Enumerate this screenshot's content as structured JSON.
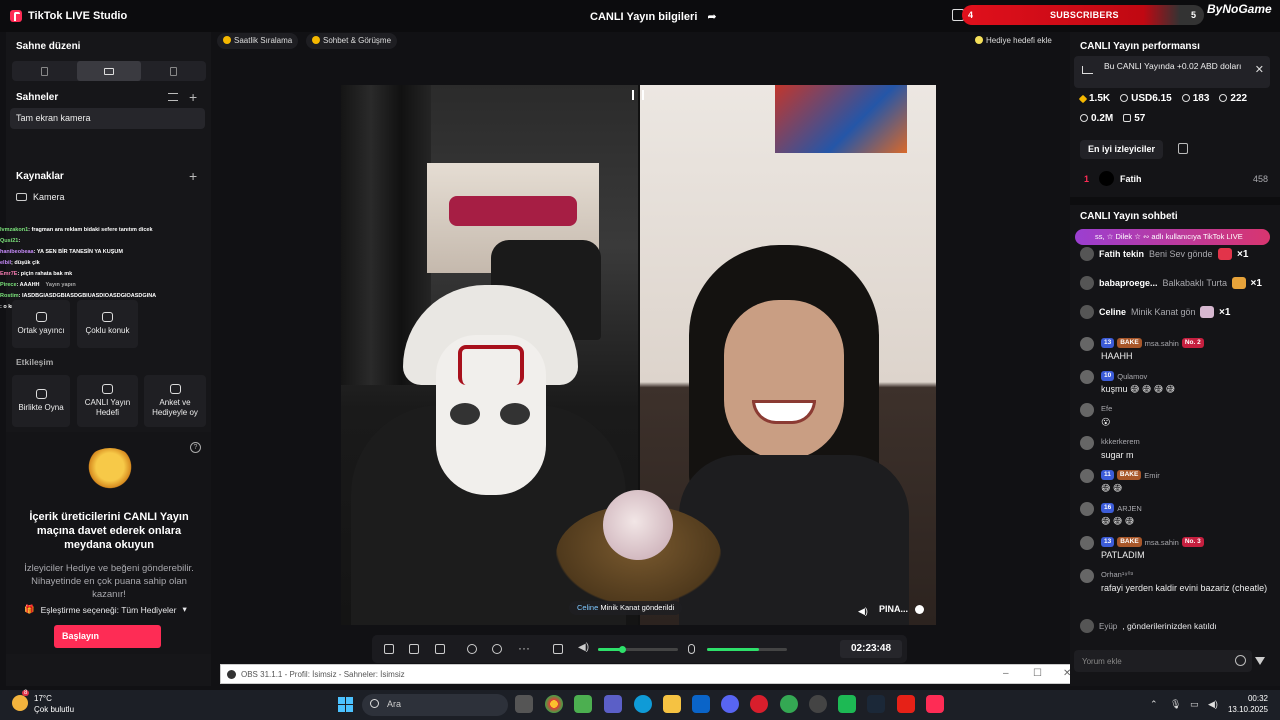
{
  "app": {
    "title": "TikTok LIVE Studio",
    "live_info_title": "CANLI Yayın bilgileri",
    "subscribers": {
      "left": "4",
      "label": "SUBSCRIBERS",
      "right": "5"
    },
    "brand": "ByNoGame"
  },
  "left": {
    "scene_layout_title": "Sahne düzeni",
    "scenes_title": "Sahneler",
    "scene_item": "Tam ekran kamera",
    "sources_title": "Kaynaklar",
    "source_item": "Kamera",
    "overlay_chat": [
      {
        "name": "lvmzakon1",
        "text": ": fragman ara reklam bidaki sefere tanıtım dicek"
      },
      {
        "name": "Qusi21",
        "text": ":"
      },
      {
        "name": "hanibeobeaa",
        "text": ": YA SEN BİR TANESİN YA KUŞUM"
      },
      {
        "name": "elbil",
        "text": "; düşük çik"
      },
      {
        "name": "Emr7E",
        "text": ": piçin rahata bak mk"
      },
      {
        "name": "Pirece",
        "text": ": AAAHH"
      },
      {
        "name": "Rostim",
        "text": ": IASDBGIASDGBIASDGBIUASDIOASDGIOASDGINA"
      },
      {
        "name": "",
        "text": ": o kızan fosil geç"
      }
    ],
    "invite_label": "Yayın yapın",
    "tiles": [
      {
        "label": "Ortak yayıncı"
      },
      {
        "label": "Çoklu konuk"
      },
      {
        "label": "Birlikte Oyna"
      },
      {
        "label": "CANLI Yayın Hedefi"
      },
      {
        "label": "Anket ve Hediyeyle oy"
      }
    ],
    "interaction_title": "Etkileşim",
    "promo": {
      "title": "İçerik üreticilerini CANLI Yayın maçına davet ederek onlara meydana okuyun",
      "body": "İzleyiciler Hediye ve beğeni gönderebilir. Nihayetinde en çok puana sahip olan kazanır!",
      "match_label": "Eşleştirme seçeneği: Tüm Hediyeler",
      "start_button": "Başlayın"
    }
  },
  "center": {
    "pills": [
      "Saatlik Sıralama",
      "Sohbet & Görüşme"
    ],
    "gift_goal": "Hediye hedefi ekle",
    "gift_toast": {
      "name": "Celine",
      "text": "Minik Kanat gönderildi"
    },
    "guest_name": "PINA...",
    "timer": "02:23:48",
    "mic_level": 0.3,
    "speaker_level": 0.65
  },
  "obs": {
    "title": "OBS 31.1.1 - Profil: İsimsiz - Sahneler: İsimsiz"
  },
  "right": {
    "performance_title": "CANLI Yayın performansı",
    "earn_text": "Bu CANLI Yayında +0.02 ABD doları",
    "stats": {
      "diamonds": "1.5K",
      "usd": "USD6.15",
      "viewers": "183",
      "followers": "222",
      "likes": "0.2M",
      "gifts": "57"
    },
    "top_viewers_button": "En iyi izleyiciler",
    "top_viewer": {
      "rank": "1",
      "name": "Fatih",
      "value": "458"
    },
    "chat_title": "CANLI Yayın sohbeti",
    "join_banner": "ss, ☆ Dilek ☆ ∾ adlı kullanıcıya TikTok LIVE",
    "gifts": [
      {
        "name": "Fatih tekin",
        "msg": "Beni Sev gönderildi",
        "count": "×1"
      },
      {
        "name": "babaproege...",
        "msg": "Balkabaklı Turta",
        "count": "×1"
      },
      {
        "name": "Celine",
        "msg": "Minik Kanat gönderildi",
        "count": "×1"
      }
    ],
    "messages": [
      {
        "level": "13",
        "team": "BAKE",
        "name": "msa.sahin",
        "rank": "No. 2",
        "text": "HAAHH"
      },
      {
        "level": "10",
        "team": "",
        "name": "Qulamov",
        "rank": "",
        "text": "kuşmu 😅 😅 😅 😅"
      },
      {
        "level": "",
        "team": "",
        "name": "Efe",
        "rank": "",
        "text": "😮"
      },
      {
        "level": "",
        "team": "",
        "name": "kkkerkerem",
        "rank": "",
        "text": "sugar m"
      },
      {
        "level": "11",
        "team": "BAKE",
        "name": "Emir",
        "rank": "",
        "text": "😅 😅"
      },
      {
        "level": "16",
        "team": "",
        "name": "ARJEN",
        "rank": "",
        "text": "😅 😅 😅"
      },
      {
        "level": "13",
        "team": "BAKE",
        "name": "msa.sahin",
        "rank": "No. 3",
        "text": "PATLADIM"
      },
      {
        "level": "",
        "team": "",
        "name": "Orhan¹⁹⁰³",
        "rank": "",
        "text": "rafayi yerden kaldir evini bazariz (cheatle)"
      }
    ],
    "joined": {
      "name": "Eyüp",
      "text": ", gönderilerinizden katıldı"
    },
    "comment_placeholder": "Yorum ekle"
  },
  "taskbar": {
    "temp": "17°C",
    "weather": "Çok bulutlu",
    "search_placeholder": "Ara",
    "time": "00:32",
    "date": "13.10.2025",
    "notif_count": "8"
  }
}
